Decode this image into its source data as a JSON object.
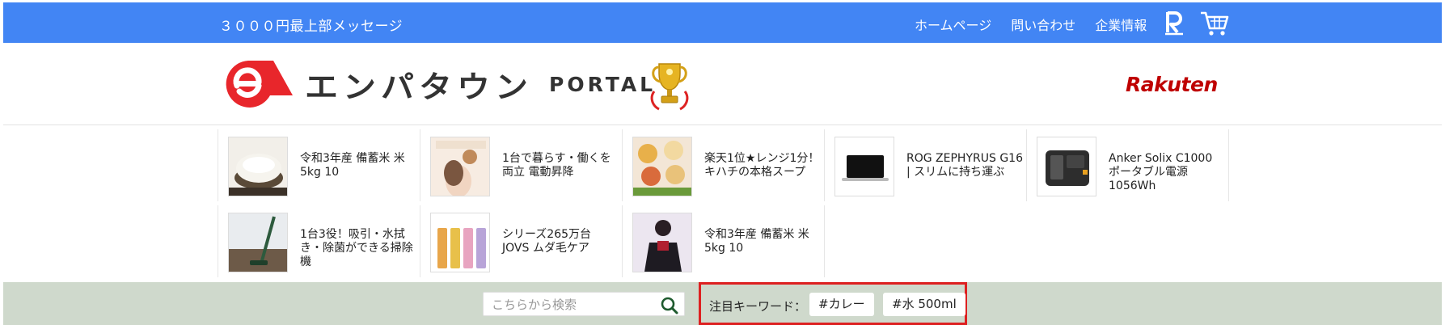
{
  "topbar": {
    "message": "３０００円最上部メッセージ",
    "nav": [
      {
        "label": "ホームページ",
        "name": "nav-home-link"
      },
      {
        "label": "問い合わせ",
        "name": "nav-contact-link"
      },
      {
        "label": "企業情報",
        "name": "nav-company-link"
      }
    ],
    "icons": [
      "rakuten-r-icon",
      "cart-icon"
    ]
  },
  "header": {
    "logo_jp": "エンパタウン",
    "logo_portal": "PORTAL",
    "rakuten_logo": "Rakuten",
    "trophy_icon": "trophy-icon"
  },
  "products": [
    {
      "title": "令和3年産 備蓄米 米 5kg 10",
      "thumb": "rice"
    },
    {
      "title": "1台で暮らす・働くを両立 電動昇降",
      "thumb": "beauty"
    },
    {
      "title": "楽天1位★レンジ1分！キハチの本格スープ",
      "thumb": "soup"
    },
    {
      "title": "ROG ZEPHYRUS G16 | スリムに持ち運ぶ",
      "thumb": "laptop"
    },
    {
      "title": "Anker Solix C1000 ポータブル電源 1056Wh",
      "thumb": "powerstation"
    },
    {
      "title": "1台3役！吸引・水拭き・除菌ができる掃除機",
      "thumb": "vacuum"
    },
    {
      "title": "シリーズ265万台 JOVS ムダ毛ケア",
      "thumb": "bottles"
    },
    {
      "title": "令和3年産 備蓄米 米 5kg 10",
      "thumb": "person"
    }
  ],
  "search": {
    "placeholder": "こちらから検索",
    "value": ""
  },
  "keywords": {
    "label": "注目キーワード：",
    "tags": [
      "#カレー",
      "#水 500ml"
    ]
  },
  "colors": {
    "topbar": "#4285f4",
    "searchbar": "#cfd9cc",
    "highlight": "#dd2020",
    "logo_red": "#e8262b",
    "rakuten_red": "#bf0000"
  }
}
